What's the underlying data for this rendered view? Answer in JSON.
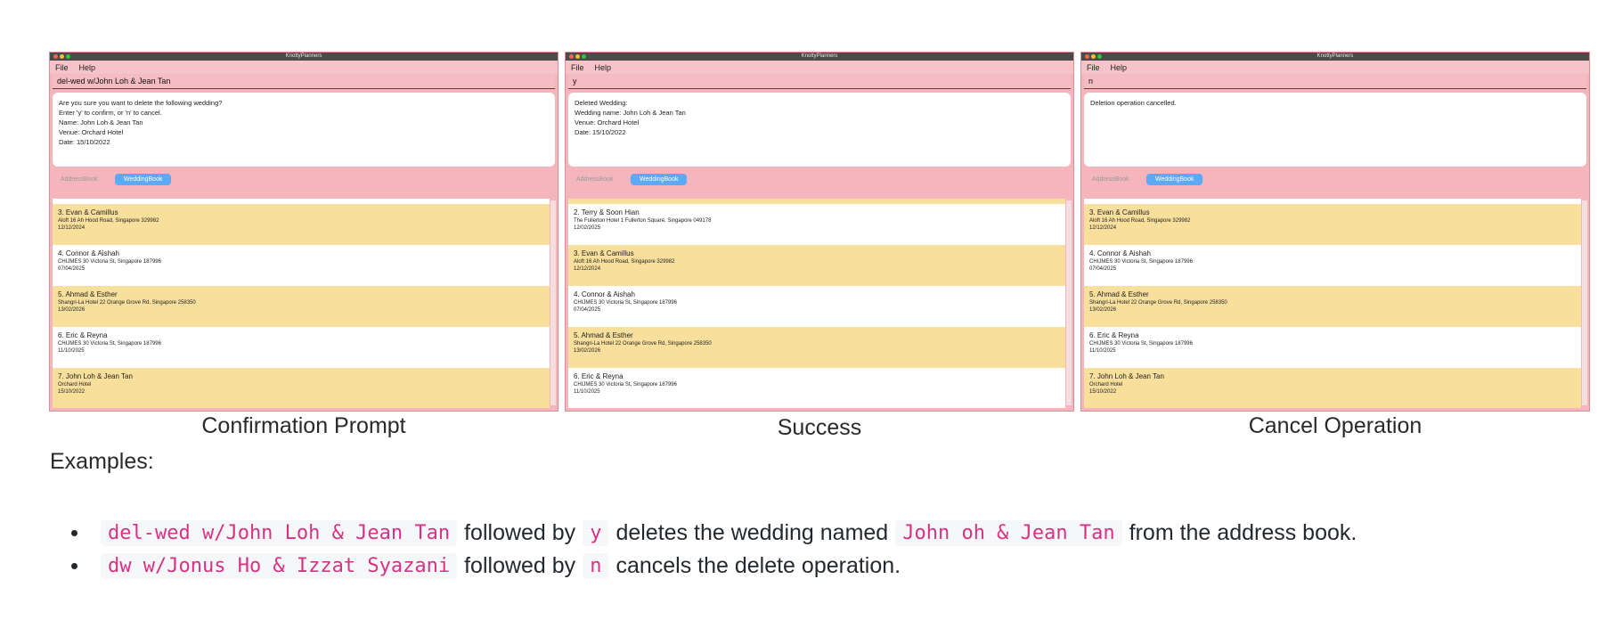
{
  "panels": [
    {
      "title": "KnottyPlanners",
      "menu": [
        "File",
        "Help"
      ],
      "command": "del-wed w/John Loh & Jean Tan",
      "result": "Are you sure you want to delete the following wedding?\nEnter 'y' to confirm, or 'n' to cancel.\nName: John Loh & Jean Tan\nVenue: Orchard Hotel\nDate: 15/10/2022",
      "tab_addressbook": "AddressBook",
      "tab_weddingbook": "WeddingBook",
      "cards": [
        {
          "name": "3. Evan & Camillus",
          "address": "Aloft 16 Ah Hood Road, Singapore 329982",
          "date": "12/12/2024"
        },
        {
          "name": "4. Connor & Aishah",
          "address": "CHIJMES 30 Victoria St, Singapore 187996",
          "date": "07/04/2025"
        },
        {
          "name": "5. Ahmad & Esther",
          "address": "Shangri-La Hotel 22 Orange Grove Rd, Singapore 258350",
          "date": "13/02/2026"
        },
        {
          "name": "6. Eric & Reyna",
          "address": "CHIJMES 30 Victoria St, Singapore 187996",
          "date": "11/10/2025"
        },
        {
          "name": "7. John Loh & Jean Tan",
          "address": "Orchard Hotel",
          "date": "15/10/2022"
        }
      ],
      "caption": "Confirmation Prompt"
    },
    {
      "title": "KnottyPlanners",
      "menu": [
        "File",
        "Help"
      ],
      "command": "y",
      "result": "Deleted Wedding:\nWedding name: John Loh & Jean Tan\nVenue: Orchard Hotel\nDate: 15/10/2022",
      "tab_addressbook": "AddressBook",
      "tab_weddingbook": "WeddingBook",
      "cards": [
        {
          "name": "2. Terry & Soon Hian",
          "address": "The Fullerton Hotel 1 Fullerton Square, Singapore 049178",
          "date": "12/02/2025"
        },
        {
          "name": "3. Evan & Camillus",
          "address": "Aloft 16 Ah Hood Road, Singapore 329982",
          "date": "12/12/2024"
        },
        {
          "name": "4. Connor & Aishah",
          "address": "CHIJMES 30 Victoria St, Singapore 187996",
          "date": "07/04/2025"
        },
        {
          "name": "5. Ahmad & Esther",
          "address": "Shangri-La Hotel 22 Orange Grove Rd, Singapore 258350",
          "date": "13/02/2026"
        },
        {
          "name": "6. Eric & Reyna",
          "address": "CHIJMES 30 Victoria St, Singapore 187996",
          "date": "11/10/2025"
        }
      ],
      "caption": "Success"
    },
    {
      "title": "KnottyPlanners",
      "menu": [
        "File",
        "Help"
      ],
      "command": "n",
      "result": "Deletion operation cancelled.",
      "tab_addressbook": "AddressBook",
      "tab_weddingbook": "WeddingBook",
      "cards": [
        {
          "name": "3. Evan & Camillus",
          "address": "Aloft 16 Ah Hood Road, Singapore 329982",
          "date": "12/12/2024"
        },
        {
          "name": "4. Connor & Aishah",
          "address": "CHIJMES 30 Victoria St, Singapore 187996",
          "date": "07/04/2025"
        },
        {
          "name": "5. Ahmad & Esther",
          "address": "Shangri-La Hotel 22 Orange Grove Rd, Singapore 258350",
          "date": "13/02/2026"
        },
        {
          "name": "6. Eric & Reyna",
          "address": "CHIJMES 30 Victoria St, Singapore 187996",
          "date": "11/10/2025"
        },
        {
          "name": "7. John Loh & Jean Tan",
          "address": "Orchard Hotel",
          "date": "15/10/2022"
        }
      ],
      "caption": "Cancel Operation"
    }
  ],
  "examples_heading": "Examples:",
  "bullets": [
    {
      "code1": "del-wed w/John Loh & Jean Tan",
      "t1": "followed by",
      "code2": "y",
      "t2": "deletes the wedding named",
      "code3": "John oh & Jean Tan",
      "t3": "from the address book."
    },
    {
      "code1": "dw w/Jonus Ho & Izzat Syazani",
      "t1": "followed by",
      "code2": "n",
      "t2": "cancels the delete operation."
    }
  ],
  "colors": {
    "pink": "#f4b5bc",
    "card_yellow": "#f8df9c",
    "tab_blue": "#5aaaf5",
    "code_pink": "#d63384"
  }
}
